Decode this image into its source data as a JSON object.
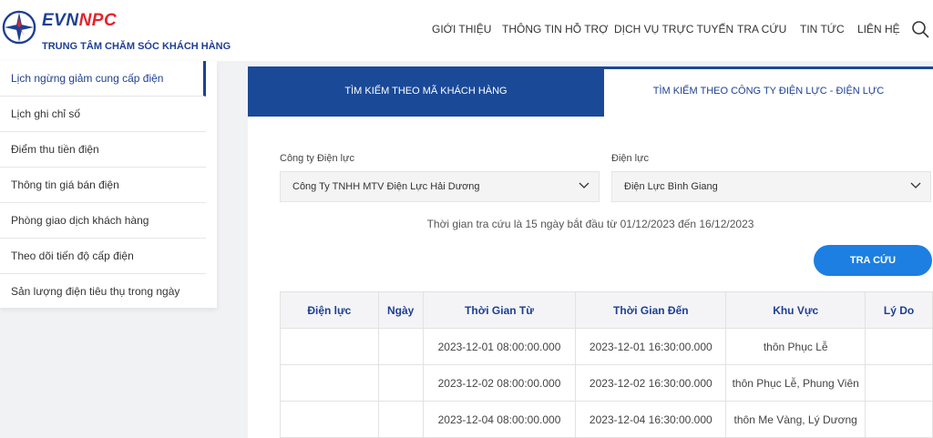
{
  "header": {
    "brand_evn": "EVN",
    "brand_npc": "NPC",
    "brand_sub": "TRUNG TÂM CHĂM SÓC KHÁCH HÀNG",
    "nav": [
      "GIỚI THIỆU",
      "THÔNG TIN HỖ TRỢ",
      "DỊCH VỤ TRỰC TUYẾN",
      "TRA CỨU",
      "TIN TỨC",
      "LIÊN HỆ"
    ]
  },
  "sidebar": {
    "items": [
      "Lịch ngừng giảm cung cấp điện",
      "Lịch ghi chỉ số",
      "Điểm thu tiền điện",
      "Thông tin giá bán điện",
      "Phòng giao dịch khách hàng",
      "Theo dõi tiến độ cấp điện",
      "Sản lượng điện tiêu thụ trong ngày"
    ],
    "active_index": 0
  },
  "tabs": {
    "left": "TÌM KIẾM THEO MÃ KHÁCH HÀNG",
    "right": "TÌM KIẾM THEO CÔNG TY ĐIỆN LỰC - ĐIỆN LỰC"
  },
  "form": {
    "company_label": "Công ty Điện lực",
    "company_value": "Công Ty TNHH MTV Điện Lực Hải Dương",
    "branch_label": "Điện lực",
    "branch_value": "Điện Lực Bình Giang",
    "info": "Thời gian tra cứu là 15 ngày bắt đầu từ 01/12/2023 đến 16/12/2023",
    "search_button": "TRA CỨU"
  },
  "table": {
    "headers": [
      "Điện lực",
      "Ngày",
      "Thời Gian Từ",
      "Thời Gian Đến",
      "Khu Vực",
      "Lý Do"
    ],
    "rows": [
      [
        "",
        "",
        "2023-12-01 08:00:00.000",
        "2023-12-01 16:30:00.000",
        "thôn Phục Lễ",
        ""
      ],
      [
        "",
        "",
        "2023-12-02 08:00:00.000",
        "2023-12-02 16:30:00.000",
        "thôn Phục Lễ, Phung Viên",
        ""
      ],
      [
        "",
        "",
        "2023-12-04 08:00:00.000",
        "2023-12-04 16:30:00.000",
        "thôn Me Vàng, Lý Dương",
        ""
      ]
    ]
  },
  "colors": {
    "brand_blue": "#1e3f94",
    "brand_red": "#e3242b",
    "tab_active": "#1a4998",
    "button_blue": "#1d7fe1"
  }
}
